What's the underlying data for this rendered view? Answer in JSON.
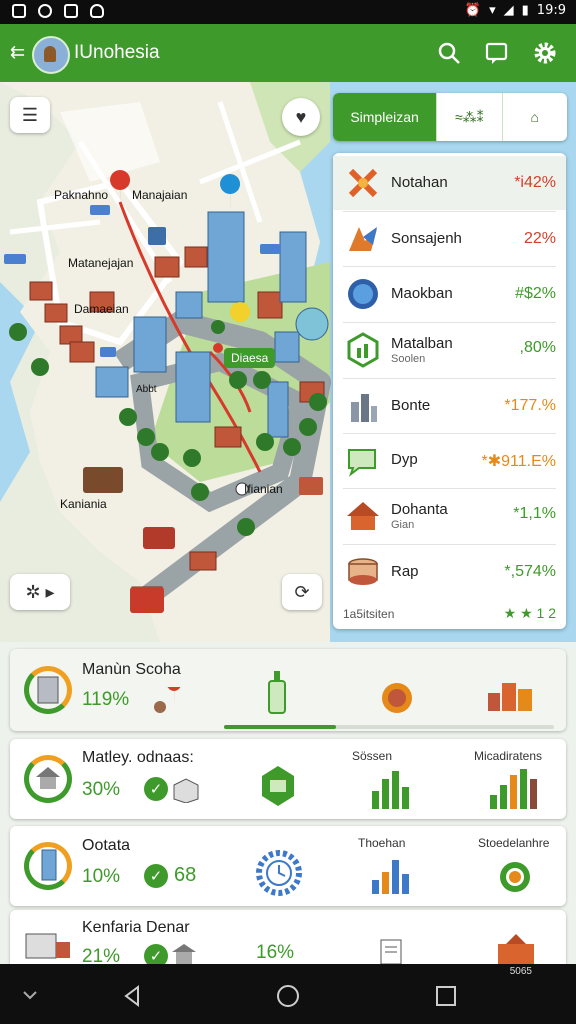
{
  "statusbar": {
    "time": "19:9"
  },
  "appbar": {
    "title": "IUnohesia"
  },
  "map": {
    "labels": {
      "l1": "Paknahno",
      "l2": "Manajaian",
      "l3": "Matanejajan",
      "l4": "Damaeian",
      "l5": "Diaesa",
      "l6": "Kaniania",
      "l7": "Ifianian",
      "l8": "Abbt"
    }
  },
  "segments": [
    {
      "label": "Simpleizan"
    },
    {
      "label": "≈⁂⁑"
    },
    {
      "label": "⌂"
    }
  ],
  "panel": {
    "rows": [
      {
        "name": "Notahan",
        "sub": "",
        "value": "*i42%",
        "color": "#d2402a"
      },
      {
        "name": "Sonsajenh",
        "sub": "",
        "value": "22%",
        "color": "#d2402a"
      },
      {
        "name": "Maokban",
        "sub": "",
        "value": "#$2%",
        "color": "#3e9a2a"
      },
      {
        "name": "Matalban",
        "sub": "Soolen",
        "value": ",80%",
        "color": "#3e9a2a"
      },
      {
        "name": "Bonte",
        "sub": "",
        "value": "*177.%",
        "color": "#e58a18"
      },
      {
        "name": "Dyp",
        "sub": "",
        "value": "*✱911.E%",
        "color": "#e58a18"
      },
      {
        "name": "Dohanta",
        "sub": "Gian",
        "value": "*1,1%",
        "color": "#3e9a2a"
      },
      {
        "name": "Rap",
        "sub": "",
        "value": "*,574%",
        "color": "#3e9a2a"
      }
    ],
    "footer": "1a5itsiten",
    "stars": "★ ★ 1 2"
  },
  "cards": {
    "c1": {
      "title": "Manùn Scoha",
      "value": "119%"
    },
    "c2": {
      "title": "Matley. odnaas:",
      "value": "30%",
      "col1": "Sössen",
      "col2": "Micadiratens"
    },
    "c3": {
      "title": "Ootata",
      "value": "10%",
      "count": "68",
      "col1": "Thoehan",
      "col2": "Stoedelanhre"
    },
    "c4": {
      "title": "Kenfaria Denar",
      "value": "21%",
      "value2": "16%",
      "mini": "5065"
    }
  },
  "colors": {
    "accent": "#3e9a2a",
    "red": "#d2402a",
    "orange": "#e58a18"
  }
}
